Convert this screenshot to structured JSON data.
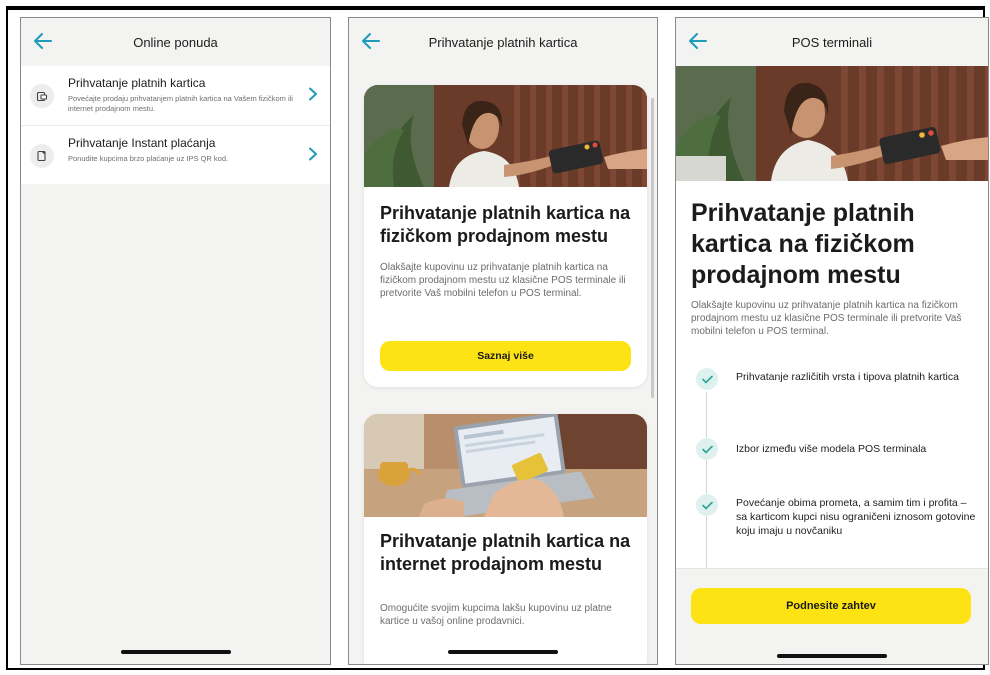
{
  "screen1": {
    "title": "Online ponuda",
    "items": [
      {
        "icon": "card-terminal-icon",
        "title": "Prihvatanje platnih kartica",
        "subtitle": "Povećajte prodaju prihvatanjem platnih kartica na Vašem fizičkom ili internet prodajnom mestu."
      },
      {
        "icon": "qr-payment-icon",
        "title": "Prihvatanje Instant plaćanja",
        "subtitle": "Ponudite kupcima brzo plaćanje uz IPS QR kod."
      }
    ]
  },
  "screen2": {
    "title": "Prihvatanje platnih kartica",
    "cards": [
      {
        "title": "Prihvatanje platnih kartica na fizičkom prodajnom mestu",
        "text": "Olakšajte kupovinu uz prihvatanje platnih kartica na fizičkom prodajnom mestu uz klasične POS terminale ili pretvorite Vaš mobilni telefon u POS terminal.",
        "button": "Saznaj više"
      },
      {
        "title": "Prihvatanje platnih kartica na internet prodajnom mestu",
        "text": "Omogućite svojim kupcima lakšu kupovinu uz platne kartice u vašoj online prodavnici."
      }
    ]
  },
  "screen3": {
    "title": "POS terminali",
    "heading": "Prihvatanje platnih kartica na fizičkom prodajnom mestu",
    "text": "Olakšajte kupovinu uz prihvatanje platnih kartica na fizičkom prodajnom mestu uz klasične POS terminale ili pretvorite Vaš mobilni telefon u POS terminal.",
    "features": [
      "Prihvatanje različitih vrsta i tipova platnih kartica",
      "Izbor između više modela POS terminala",
      "Povećanje obima prometa, a samim tim i profita – sa karticom kupci nisu ograničeni iznosom gotovine koju imaju u novčaniku"
    ],
    "button": "Podnesite zahtev"
  },
  "colors": {
    "accent": "#1c9cb8",
    "button_yellow": "#fde313",
    "check_bg": "#dff1ef",
    "background": "#f3f3f1"
  }
}
